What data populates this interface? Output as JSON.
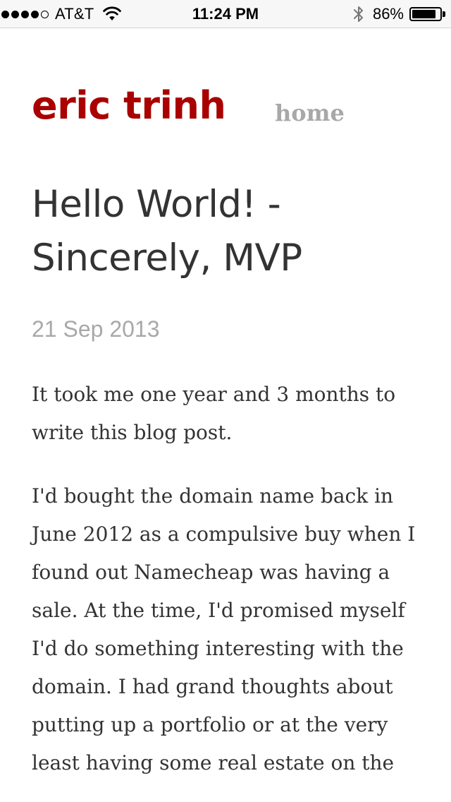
{
  "status_bar": {
    "signal_bars_filled": 4,
    "signal_bars_total": 5,
    "carrier": "AT&T",
    "wifi_icon": "wifi-icon",
    "time": "11:24 PM",
    "bluetooth_icon": "bluetooth-icon",
    "battery_percent": "86%",
    "battery_level": 0.86
  },
  "site": {
    "title": "eric trinh",
    "title_color": "#a90000",
    "nav_home": "home"
  },
  "post": {
    "title": "Hello World! - Sincerely, MVP",
    "date": "21 Sep 2013",
    "paragraphs": [
      "It took me one year and 3 months to write this blog post.",
      "I'd bought the domain name back in June 2012 as a compulsive buy when I found out Namecheap was having a sale.  At the time, I'd promised myself I'd do something interesting with the domain. I had grand thoughts about putting up a portfolio or at the very least having some real estate on the"
    ]
  }
}
